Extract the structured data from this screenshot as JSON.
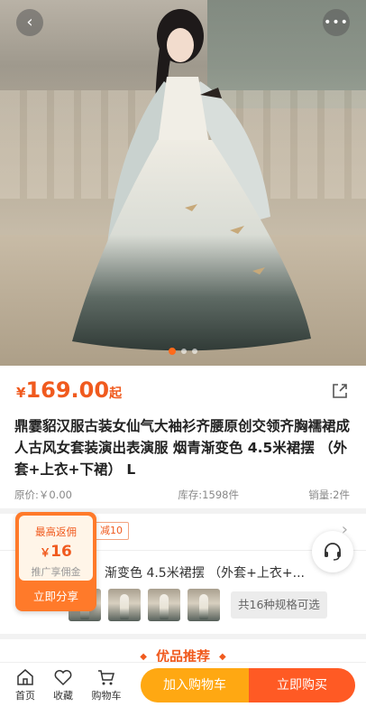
{
  "product": {
    "currency": "¥",
    "price": "169.00",
    "price_suffix": "起",
    "title": "鼎霎貂汉服古装女仙气大袖衫齐腰原创交领齐胸襦裙成人古风女套装演出表演服 烟青渐变色 4.5米裙摆 （外套+上衣+下裙） L",
    "original_price": "原价:￥0.00",
    "stock": "库存:1598件",
    "sales": "销量:2件"
  },
  "gallery": {
    "total": 3,
    "active": 0
  },
  "coupon": {
    "tag": "减10"
  },
  "spec": {
    "selected": "渐变色 4.5米裙摆 （外套+上衣+...",
    "count_label": "共16种规格可选"
  },
  "commission": {
    "title": "最高返佣",
    "amount": "16",
    "currency": "￥",
    "subtitle": "推广享佣金",
    "button": "立即分享"
  },
  "recommend": {
    "title": "优品推荐"
  },
  "bottom_nav": {
    "home": "首页",
    "favorite": "收藏",
    "cart": "购物车",
    "add_cart": "加入购物车",
    "buy_now": "立即购买"
  },
  "icons": {
    "back": "back-icon",
    "more": "more-icon",
    "share": "share-icon",
    "customer_service": "headset-icon"
  },
  "colors": {
    "accent": "#f05a1e",
    "cart_button": "#ffa812",
    "buy_button": "#ff5a24"
  }
}
